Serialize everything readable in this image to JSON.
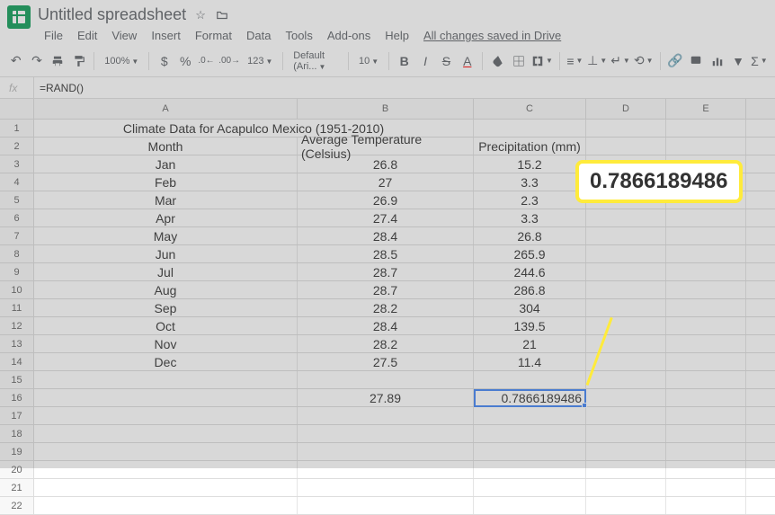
{
  "doc_title": "Untitled spreadsheet",
  "menubar": [
    "File",
    "Edit",
    "View",
    "Insert",
    "Format",
    "Data",
    "Tools",
    "Add-ons",
    "Help"
  ],
  "drive_status": "All changes saved in Drive",
  "toolbar": {
    "zoom": "100%",
    "currency": "$",
    "percent": "%",
    "font": "Default (Ari...",
    "size": "10"
  },
  "formula": "=RAND()",
  "columns": [
    "A",
    "B",
    "C",
    "D",
    "E"
  ],
  "col_widths": {
    "A": 293,
    "B": 196,
    "C": 125,
    "D": 89,
    "E": 89
  },
  "rows_visible": 22,
  "data_rows": {
    "1": {
      "A": "Climate Data for Acapulco Mexico (1951-2010)",
      "B": "",
      "C": ""
    },
    "2": {
      "A": "Month",
      "B": "Average Temperature (Celsius)",
      "C": "Precipitation (mm)"
    },
    "3": {
      "A": "Jan",
      "B": "26.8",
      "C": "15.2"
    },
    "4": {
      "A": "Feb",
      "B": "27",
      "C": "3.3"
    },
    "5": {
      "A": "Mar",
      "B": "26.9",
      "C": "2.3"
    },
    "6": {
      "A": "Apr",
      "B": "27.4",
      "C": "3.3"
    },
    "7": {
      "A": "May",
      "B": "28.4",
      "C": "26.8"
    },
    "8": {
      "A": "Jun",
      "B": "28.5",
      "C": "265.9"
    },
    "9": {
      "A": "Jul",
      "B": "28.7",
      "C": "244.6"
    },
    "10": {
      "A": "Aug",
      "B": "28.7",
      "C": "286.8"
    },
    "11": {
      "A": "Sep",
      "B": "28.2",
      "C": "304"
    },
    "12": {
      "A": "Oct",
      "B": "28.4",
      "C": "139.5"
    },
    "13": {
      "A": "Nov",
      "B": "28.2",
      "C": "21"
    },
    "14": {
      "A": "Dec",
      "B": "27.5",
      "C": "11.4"
    },
    "16": {
      "B": "27.89",
      "C": "0.7866189486"
    }
  },
  "selected_cell": "C16",
  "callout_value": "0.7866189486"
}
